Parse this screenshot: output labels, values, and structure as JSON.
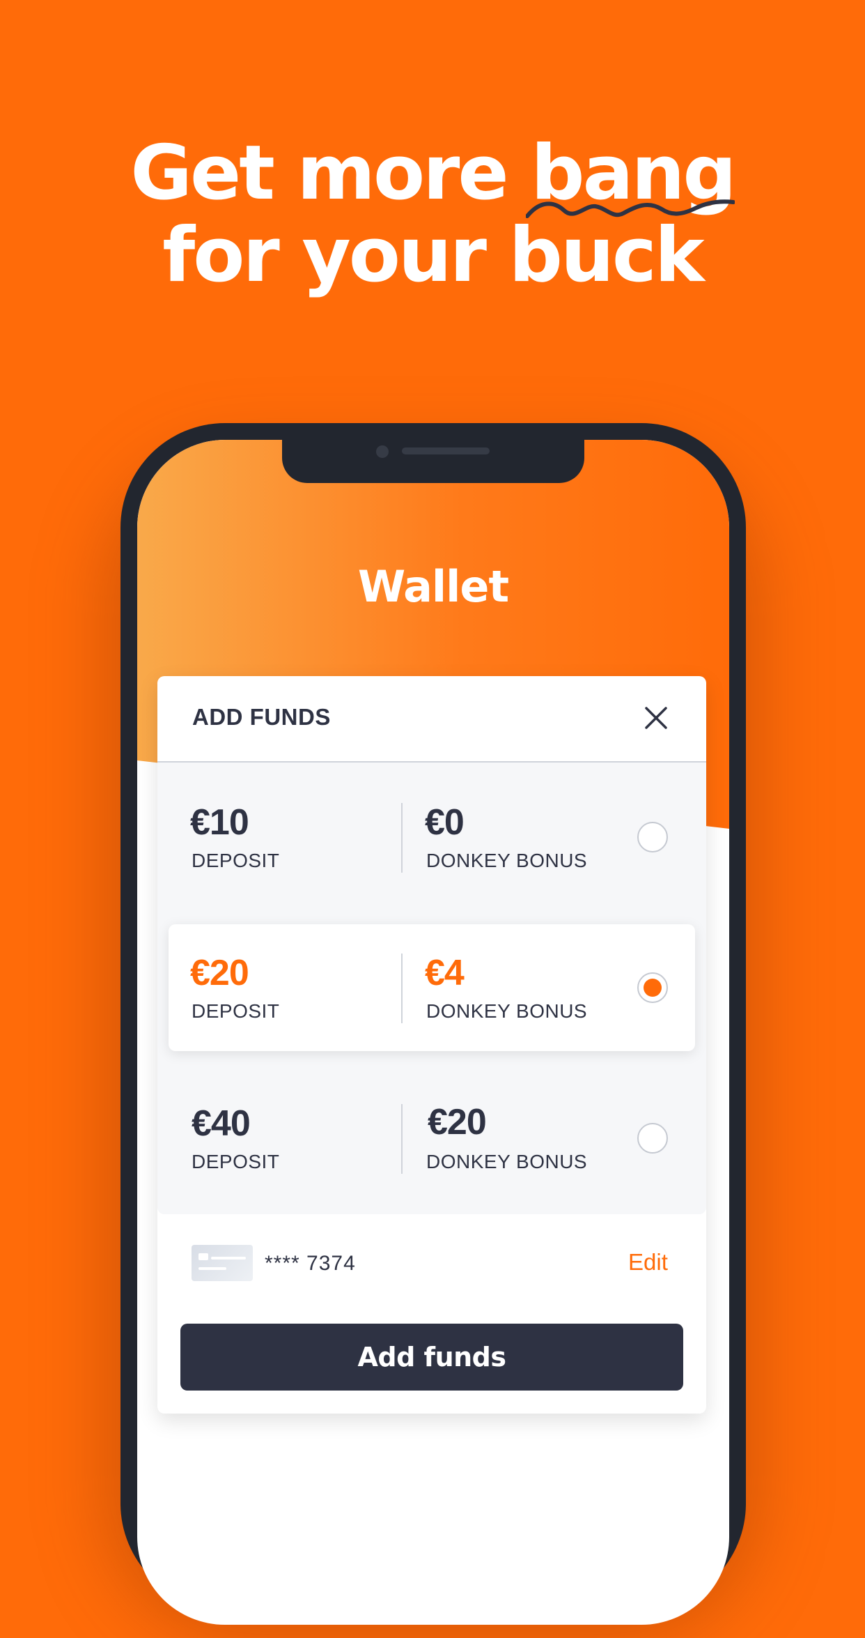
{
  "headline": {
    "line1": "Get more bang",
    "line2": "for your buck"
  },
  "wallet": {
    "title": "Wallet"
  },
  "add_funds_panel": {
    "title": "ADD FUNDS",
    "options": [
      {
        "deposit": "€10",
        "deposit_label": "DEPOSIT",
        "bonus": "€0",
        "bonus_label": "DONKEY BONUS",
        "selected": false
      },
      {
        "deposit": "€20",
        "deposit_label": "DEPOSIT",
        "bonus": "€4",
        "bonus_label": "DONKEY BONUS",
        "selected": true
      },
      {
        "deposit": "€40",
        "deposit_label": "DEPOSIT",
        "bonus": "€20",
        "bonus_label": "DONKEY BONUS",
        "selected": false
      }
    ],
    "payment": {
      "card_number": "**** 7374",
      "edit_label": "Edit"
    },
    "submit_label": "Add funds"
  },
  "colors": {
    "brand_orange": "#ff6b09",
    "gradient_light": "#f9a94a",
    "dark_navy": "#2e3243",
    "phone_frame": "#22262f"
  },
  "icons": {
    "close": "close-icon",
    "radio": "radio-icon",
    "card": "credit-card-icon"
  }
}
